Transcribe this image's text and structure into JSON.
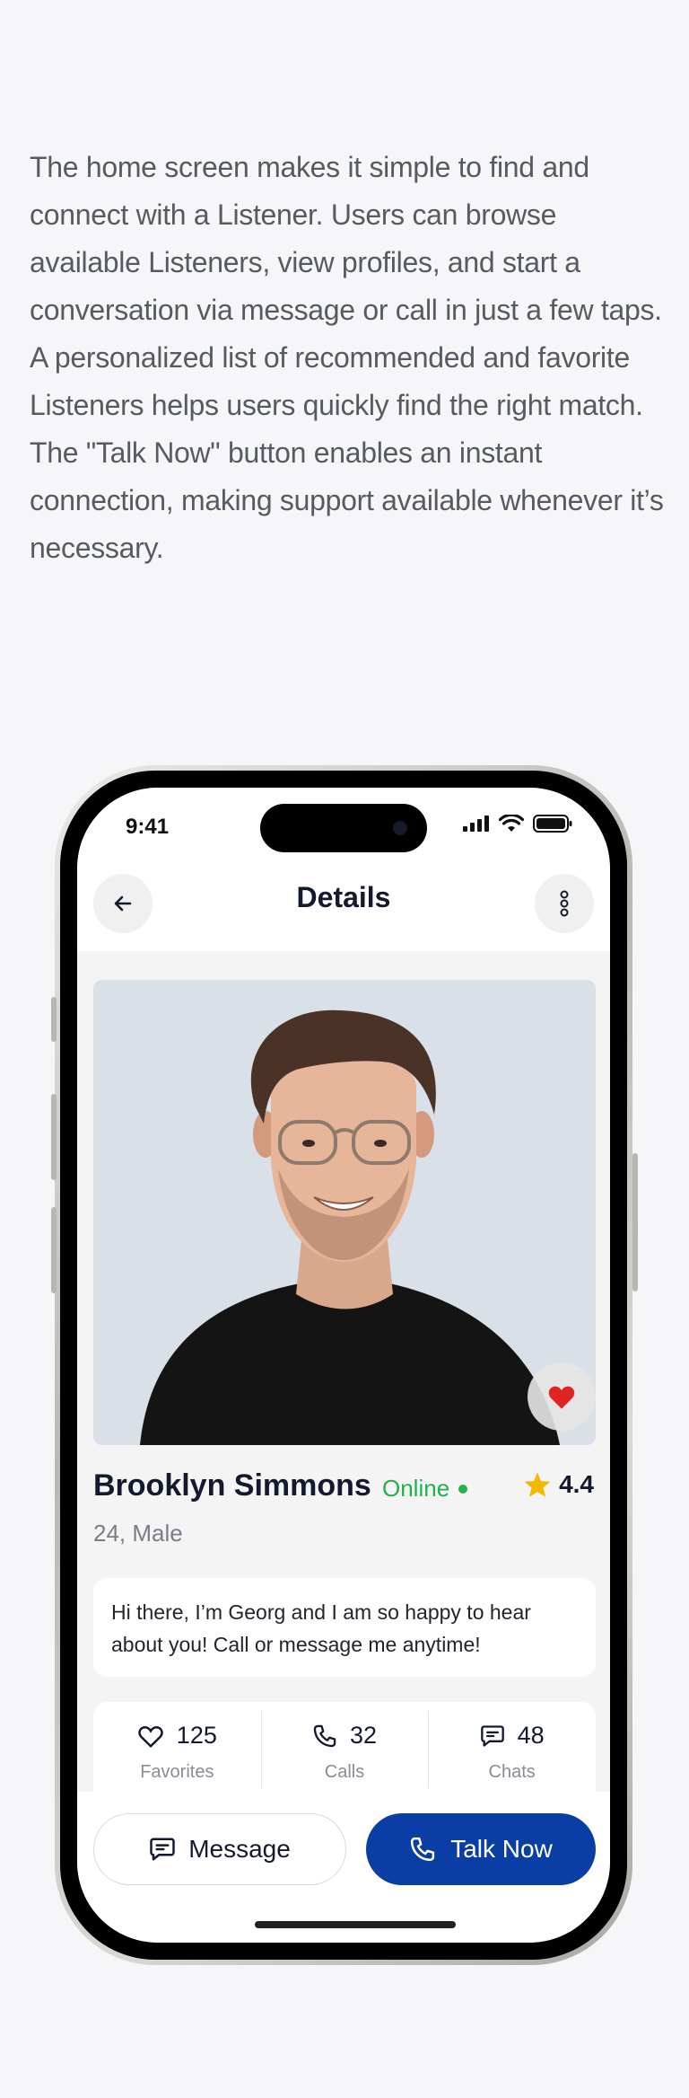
{
  "intro_text": "The home screen makes it simple to find and connect with a Listener. Users can browse available Listeners, view profiles, and start a conversation via message or call in just a few taps. A personalized list of recommended and favorite Listeners helps users quickly find the right match. The \"Talk Now\" button enables an instant connection, making support available whenever it’s necessary.",
  "status_bar": {
    "time": "9:41"
  },
  "header": {
    "title": "Details"
  },
  "profile": {
    "name": "Brooklyn Simmons",
    "status": "Online",
    "rating": "4.4",
    "subtitle": "24, Male",
    "bio": "Hi there, I’m Georg and I am so happy to hear about you! Call or message me anytime!"
  },
  "stats": [
    {
      "value": "125",
      "label": "Favorites",
      "icon": "heart-icon"
    },
    {
      "value": "32",
      "label": "Calls",
      "icon": "phone-icon"
    },
    {
      "value": "48",
      "label": "Chats",
      "icon": "chat-icon"
    }
  ],
  "actions": {
    "message_label": "Message",
    "talk_label": "Talk Now"
  },
  "colors": {
    "accent": "#0b3ea5",
    "online": "#22b14c",
    "favorite": "#e02424",
    "star": "#f5b800"
  }
}
